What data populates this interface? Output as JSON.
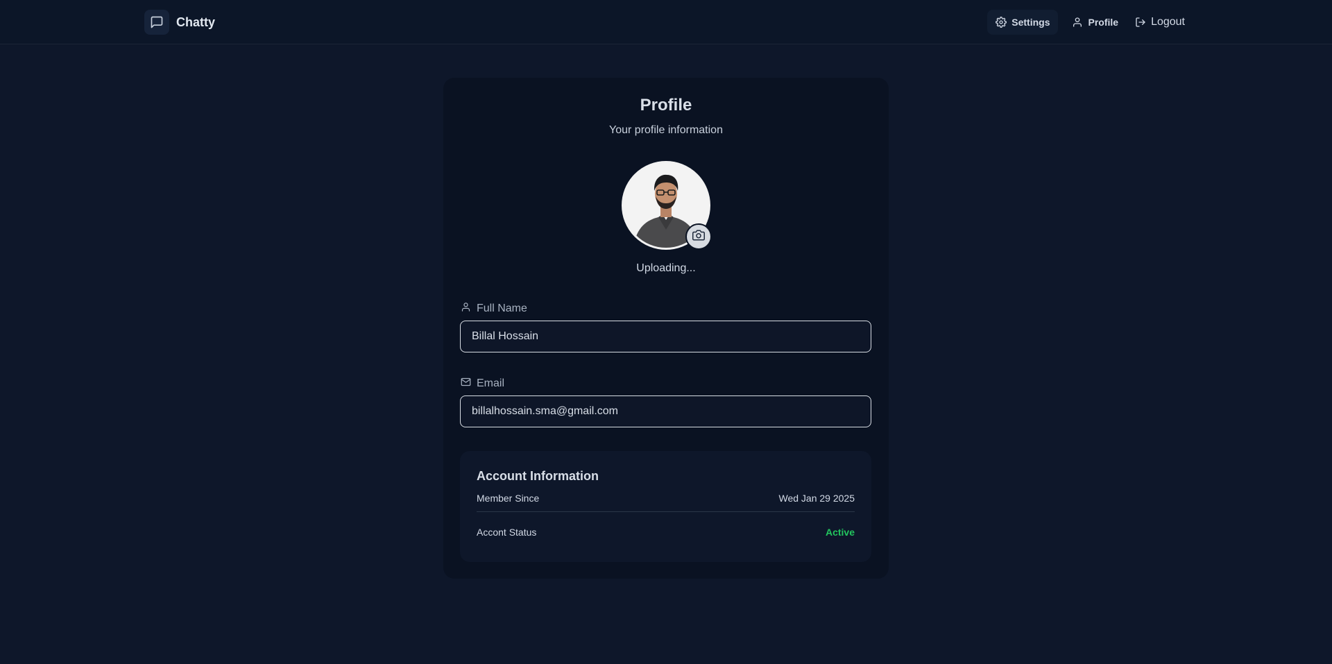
{
  "navbar": {
    "brand_name": "Chatty",
    "brand_icon": "message-square-icon",
    "settings_label": "Settings",
    "profile_label": "Profile",
    "logout_label": "Logout"
  },
  "profile": {
    "title": "Profile",
    "subtitle": "Your profile information",
    "upload_status": "Uploading...",
    "full_name_label": "Full Name",
    "full_name_value": "Billal Hossain",
    "email_label": "Email",
    "email_value": "billalhossain.sma@gmail.com"
  },
  "account": {
    "title": "Account Information",
    "member_since_label": "Member Since",
    "member_since_value": "Wed Jan 29 2025",
    "status_label": "Accont Status",
    "status_value": "Active"
  },
  "colors": {
    "background": "#0e172a",
    "card": "#0a1222",
    "active_status": "#22c55e"
  }
}
